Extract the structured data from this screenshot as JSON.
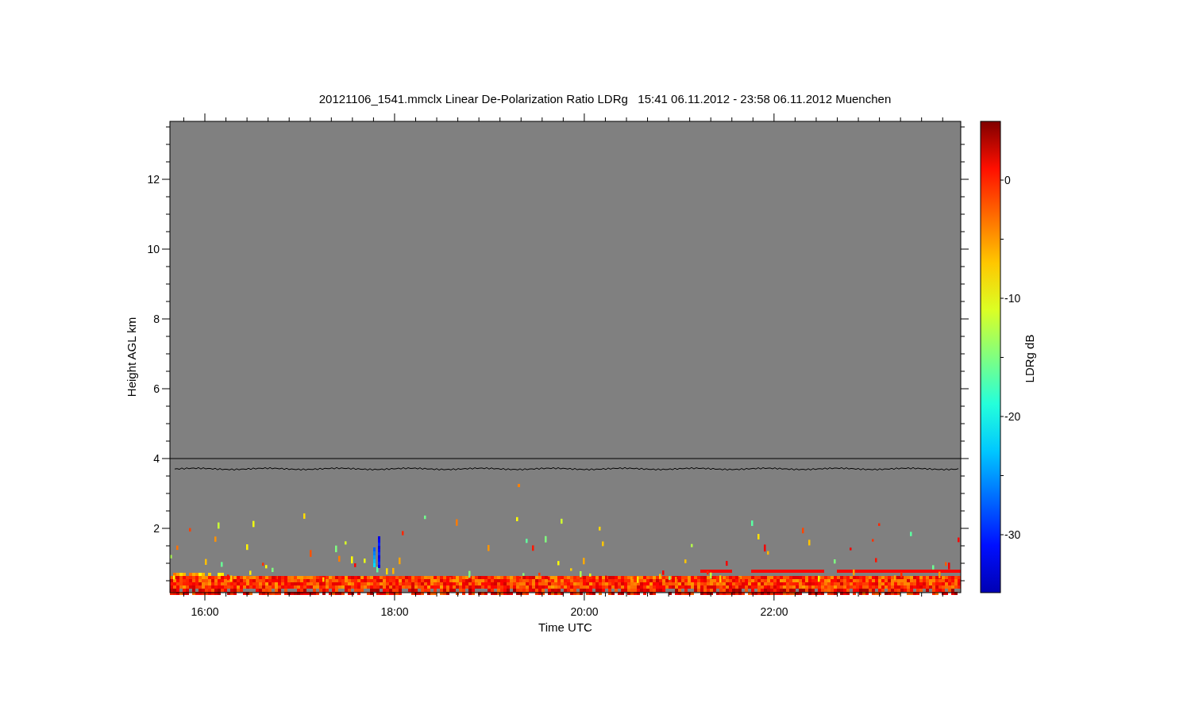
{
  "title": "20121106_1541.mmclx Linear De-Polarization Ratio LDRg   15:41 06.11.2012 - 23:58 06.11.2012 Muenchen",
  "plot": {
    "ylabel": "Height AGL km",
    "xlabel": "Time UTC",
    "yticks": [
      "12",
      "10",
      "8",
      "6",
      "4",
      "2"
    ],
    "xticks": [
      "16:00",
      "18:00",
      "20:00",
      "22:00"
    ]
  },
  "colorbar": {
    "label": "LDRg dB",
    "ticks": [
      "0",
      "-10",
      "-20",
      "-30"
    ]
  }
}
